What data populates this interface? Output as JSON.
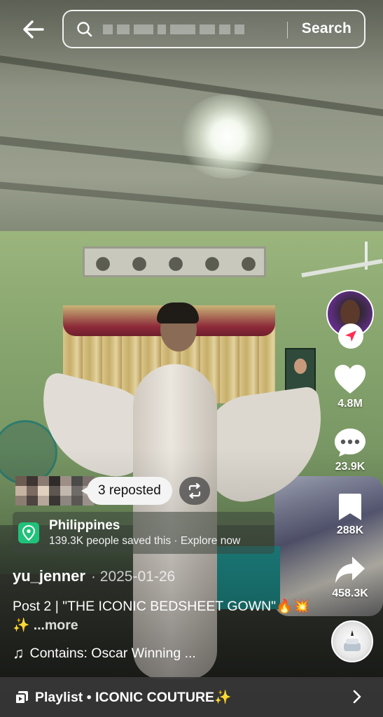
{
  "search": {
    "placeholder": "",
    "button_label": "Search"
  },
  "repost": {
    "label": "3 reposted"
  },
  "actions": {
    "likes": "4.8M",
    "comments": "23.9K",
    "saves": "288K",
    "shares": "458.3K"
  },
  "location": {
    "title": "Philippines",
    "subtitle": "139.3K people saved this · Explore now"
  },
  "post": {
    "username": "yu_jenner",
    "date": "· 2025-01-26",
    "caption": "Post 2 | \"THE ICONIC BEDSHEET GOWN\"🔥💥✨",
    "more_label": "...more",
    "sound": "Contains: Oscar Winning ..."
  },
  "playlist": {
    "label": "Playlist • ICONIC COUTURE✨"
  },
  "icons": [
    "back-arrow-icon",
    "search-icon",
    "follow-icon",
    "heart-icon",
    "comment-icon",
    "bookmark-icon",
    "share-icon",
    "repost-icon",
    "location-pin-icon",
    "music-note-icon",
    "playlist-icon",
    "chevron-right-icon"
  ],
  "colors": {
    "location_pin": "#20c27a",
    "follow_arrow": "#fe2c55",
    "playlist_bar": "#373737"
  }
}
